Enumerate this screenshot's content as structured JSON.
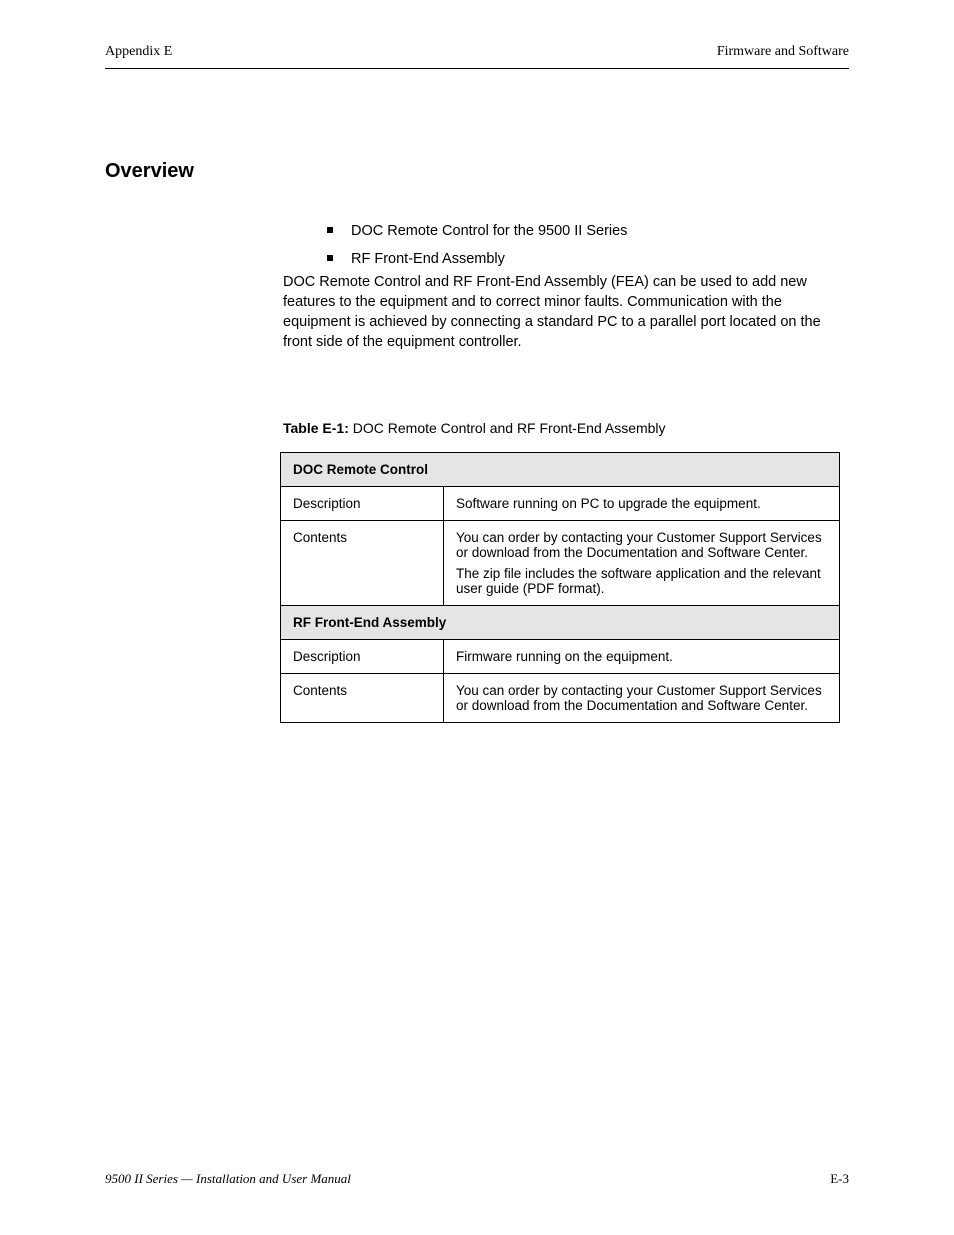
{
  "header": {
    "left": "Appendix E",
    "right": "Firmware and Software"
  },
  "section_title": "Overview",
  "bullets": [
    "DOC Remote Control for the 9500 II Series",
    "RF Front-End Assembly"
  ],
  "intro_para": "DOC Remote Control and RF Front-End Assembly (FEA) can be used to add new features to the equipment and to correct minor faults. Communication with the equipment is achieved by connecting a standard PC to a parallel port located on the front side of the equipment controller.",
  "table": {
    "caption_prefix": "Table E-1: ",
    "caption_text": "DOC Remote Control and RF Front-End Assembly",
    "groups": [
      {
        "header": "DOC Remote Control",
        "rows": [
          {
            "label": "Description",
            "value": "Software running on PC to upgrade the equipment."
          },
          {
            "label": "Contents",
            "lines": [
              "You can order by contacting your Customer Support Services or download from the Documentation and Software Center.",
              "The zip file includes the software application and the relevant user guide (PDF format)."
            ]
          }
        ]
      },
      {
        "header": "RF Front-End Assembly",
        "rows": [
          {
            "label": "Description",
            "value": "Firmware running on the equipment."
          },
          {
            "label": "Contents",
            "lines": [
              "You can order by contacting your Customer Support Services or download from the Documentation and Software Center."
            ]
          }
        ]
      }
    ]
  },
  "footer": {
    "note": "9500 II Series — Installation and User Manual",
    "page": "E-3"
  }
}
